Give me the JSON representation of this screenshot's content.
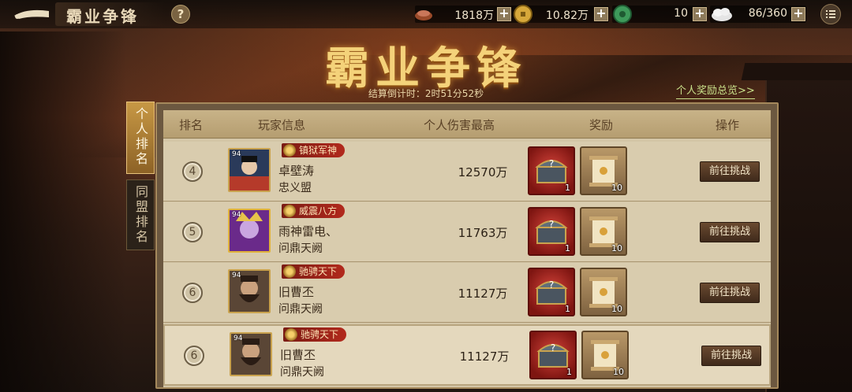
{
  "header": {
    "title": "霸业争锋",
    "help_label": "?",
    "resources": [
      {
        "icon": "copper-ingot-icon",
        "value": "1818万",
        "plus": "+"
      },
      {
        "icon": "gold-coin-icon",
        "value": "10.82万",
        "plus": "+"
      },
      {
        "icon": "jade-icon",
        "value": "10",
        "plus": "+"
      },
      {
        "icon": "stamina-cloud-icon",
        "value": "86/360",
        "plus": "+"
      }
    ]
  },
  "banner": {
    "title": "霸业争锋",
    "countdown": "结算倒计时：2时51分52秒",
    "reward_link": "个人奖励总览>>"
  },
  "tabs": [
    {
      "label": "个人排名",
      "active": true
    },
    {
      "label": "同盟排名",
      "active": false
    }
  ],
  "table": {
    "headers": {
      "rank": "排名",
      "player": "玩家信息",
      "damage": "个人伤害最高",
      "rewards": "奖励",
      "action": "操作"
    },
    "rows": [
      {
        "rank": "4",
        "level": "94",
        "title": "镇狱军神",
        "name": "卓壁涛",
        "alliance": "忠义盟",
        "damage": "12570万",
        "chest_count": "1",
        "scroll_count": "10",
        "action": "前往挑战"
      },
      {
        "rank": "5",
        "level": "94",
        "title": "威震八方",
        "name": "雨神雷电、",
        "alliance": "问鼎天阙",
        "damage": "11763万",
        "chest_count": "1",
        "scroll_count": "10",
        "action": "前往挑战"
      },
      {
        "rank": "6",
        "level": "94",
        "title": "驰骋天下",
        "name": "旧曹丕",
        "alliance": "问鼎天阙",
        "damage": "11127万",
        "chest_count": "1",
        "scroll_count": "10",
        "action": "前往挑战"
      },
      {
        "rank": "6",
        "level": "94",
        "title": "驰骋天下",
        "name": "旧曹丕",
        "alliance": "问鼎天阙",
        "damage": "11127万",
        "chest_count": "1",
        "scroll_count": "10",
        "action": "前往挑战"
      }
    ]
  },
  "colors": {
    "accent_gold": "#f4d27a",
    "badge_red": "#b2291c",
    "link_green": "#c9e08a"
  }
}
